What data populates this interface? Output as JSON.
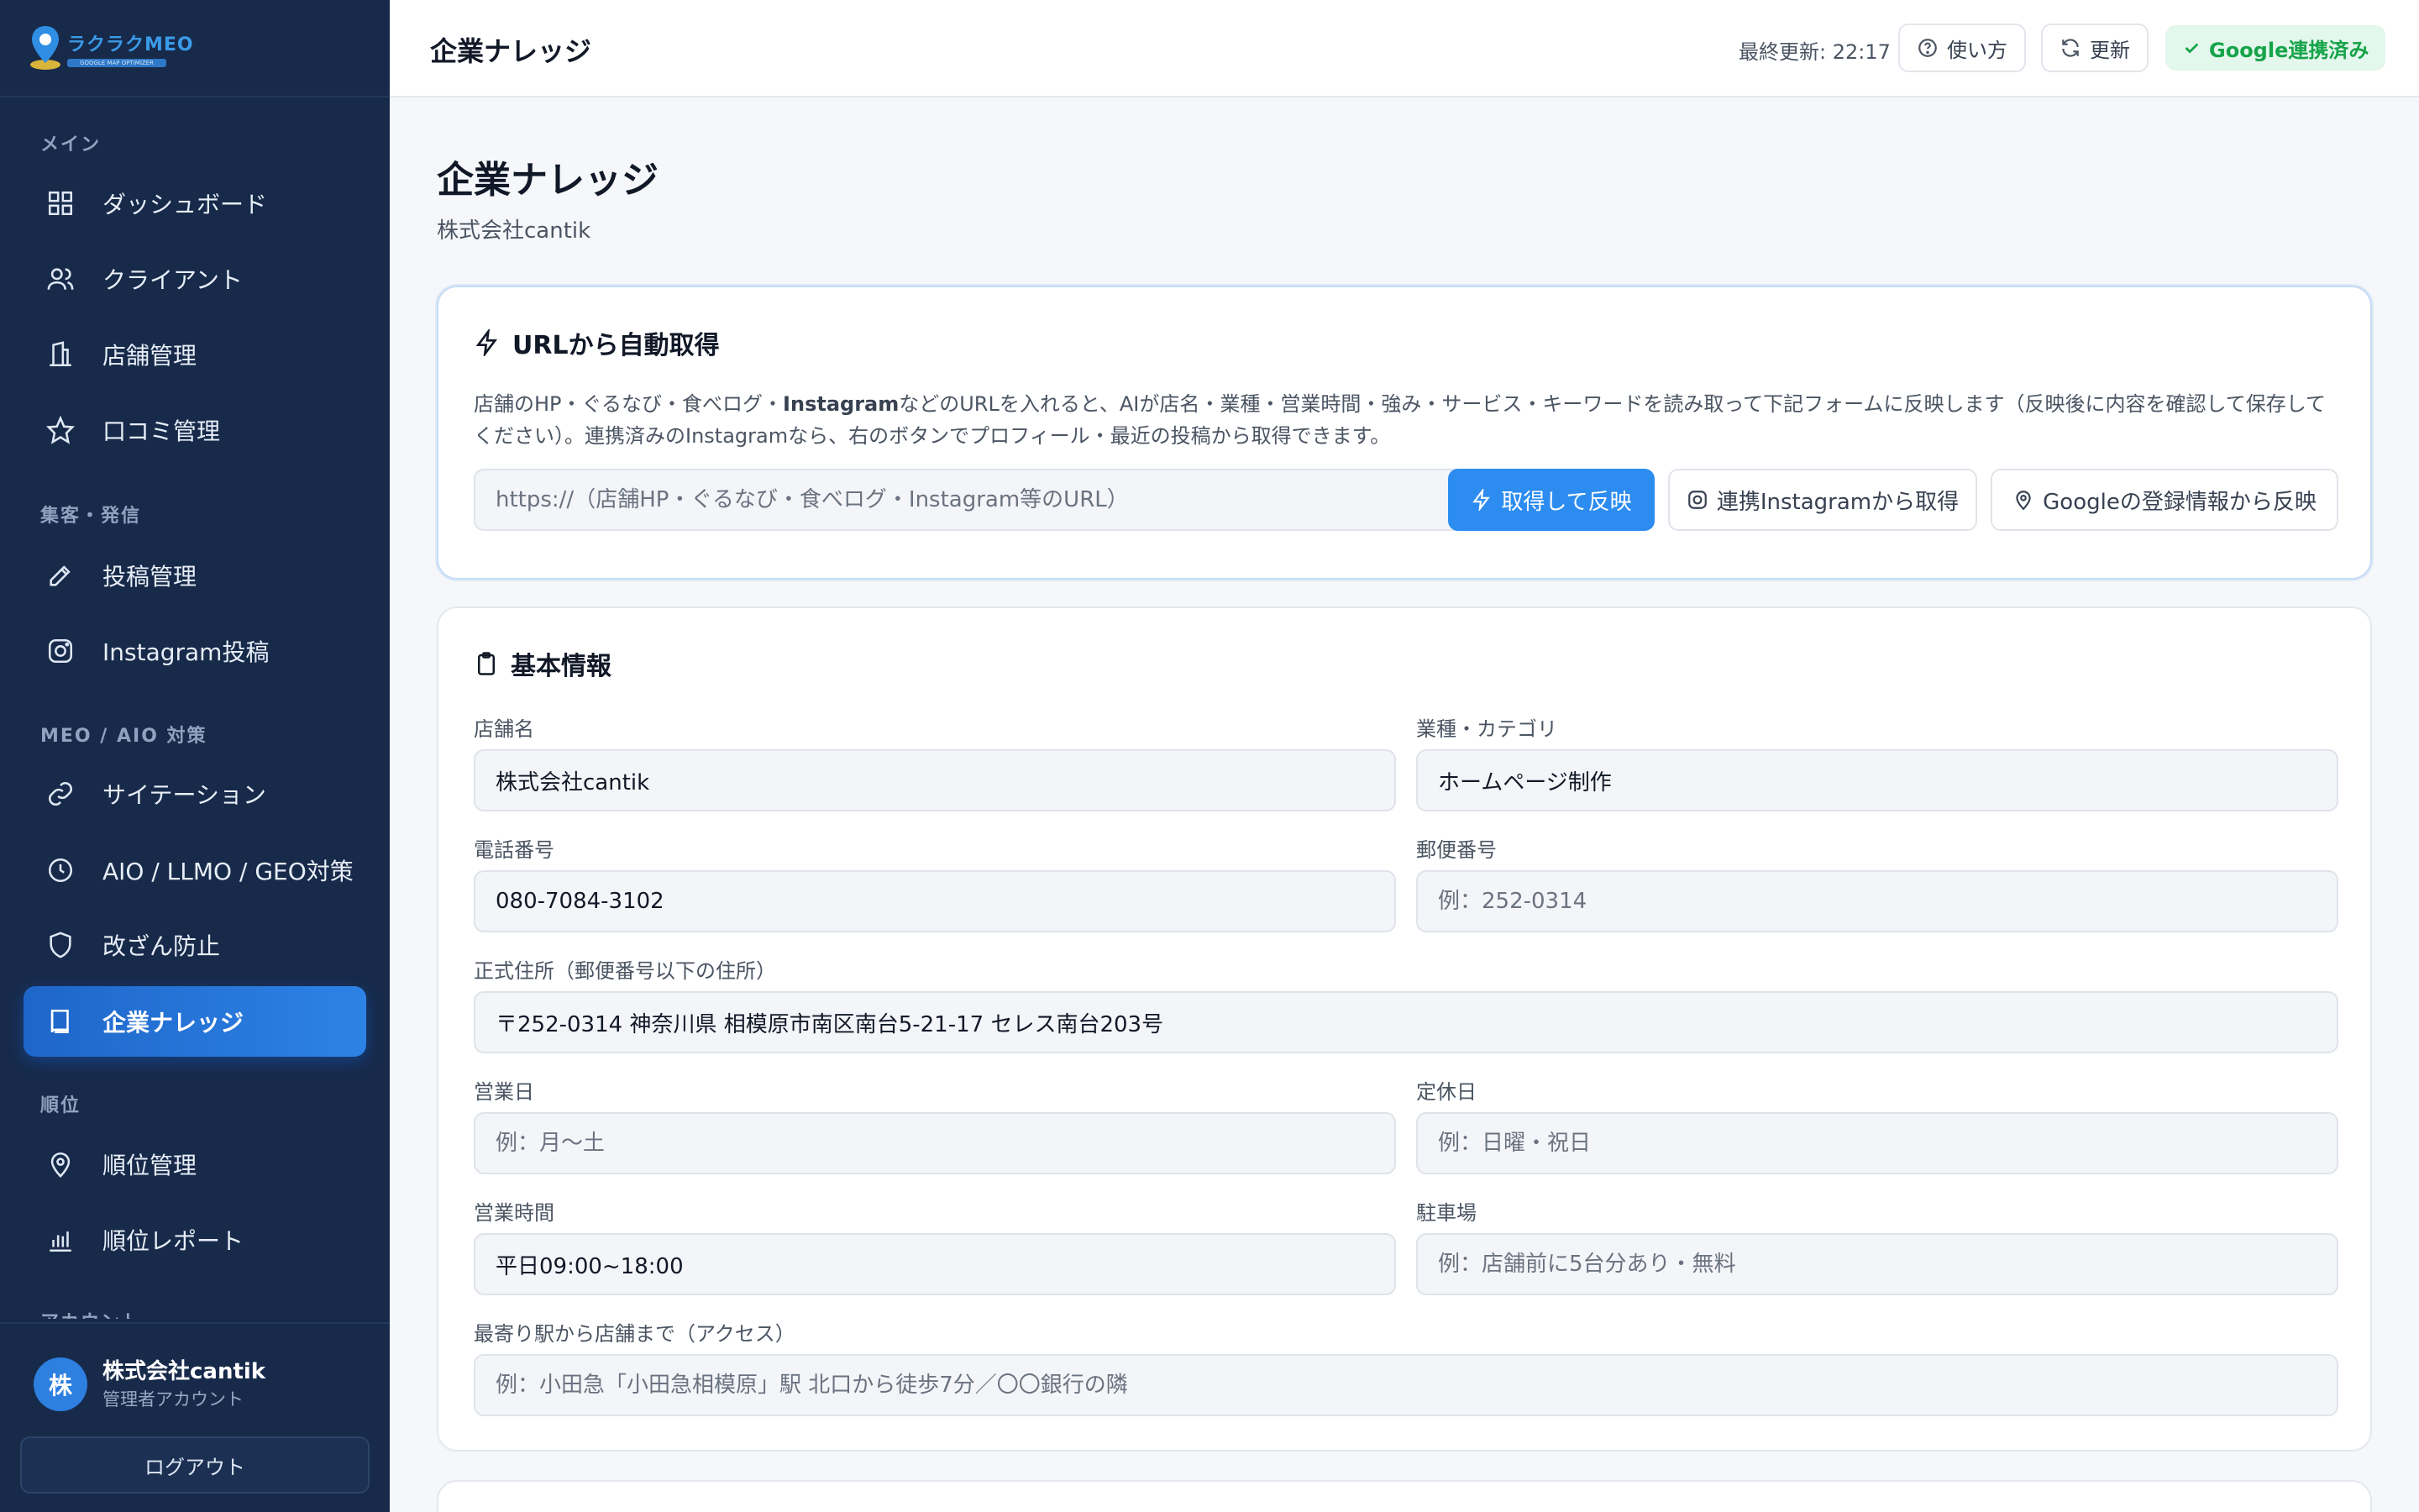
{
  "brand": {
    "name": "ラクラクMEO",
    "tagline": "GOOGLE MAP OPTIMIZER"
  },
  "sidebar": {
    "sections": {
      "main": "メイン",
      "attract": "集客・発信",
      "meo": "MEO / AIO 対策",
      "rank": "順位",
      "account": "アカウント"
    },
    "items": [
      {
        "label": "ダッシュボード"
      },
      {
        "label": "クライアント"
      },
      {
        "label": "店舗管理"
      },
      {
        "label": "口コミ管理"
      },
      {
        "label": "投稿管理"
      },
      {
        "label": "Instagram投稿"
      },
      {
        "label": "サイテーション"
      },
      {
        "label": "AIO / LLMO / GEO対策"
      },
      {
        "label": "改ざん防止"
      },
      {
        "label": "企業ナレッジ"
      },
      {
        "label": "順位管理"
      },
      {
        "label": "順位レポート"
      }
    ],
    "active_index": 9
  },
  "user": {
    "avatar": "株",
    "name": "株式会社cantik",
    "role": "管理者アカウント",
    "logout": "ログアウト"
  },
  "header": {
    "title": "企業ナレッジ",
    "last_update": "最終更新: 22:17",
    "help": "使い方",
    "refresh": "更新",
    "google": "Google連携済み"
  },
  "page": {
    "title": "企業ナレッジ",
    "subtitle": "株式会社cantik"
  },
  "auto_fetch": {
    "title": "URLから自動取得",
    "desc_pre": "店舗のHP・ぐるなび・食べログ・",
    "desc_bold": "Instagram",
    "desc_post": "などのURLを入れると、AIが店名・業種・営業時間・強み・サービス・キーワードを読み取って下記フォームに反映します（反映後に内容を確認して保存してください）。連携済みのInstagramなら、右のボタンでプロフィール・最近の投稿から取得できます。",
    "url_placeholder": "https://（店舗HP・ぐるなび・食べログ・Instagram等のURL）",
    "fetch_button": "取得して反映",
    "instagram_button": "連携Instagramから取得",
    "google_button": "Googleの登録情報から反映"
  },
  "basic": {
    "title": "基本情報",
    "store_name": {
      "label": "店舗名",
      "value": "株式会社cantik",
      "placeholder": ""
    },
    "category": {
      "label": "業種・カテゴリ",
      "value": "ホームページ制作",
      "placeholder": ""
    },
    "phone": {
      "label": "電話番号",
      "value": "080-7084-3102",
      "placeholder": ""
    },
    "postal": {
      "label": "郵便番号",
      "value": "",
      "placeholder": "例：252-0314"
    },
    "address": {
      "label": "正式住所（郵便番号以下の住所）",
      "value": "〒252-0314 神奈川県 相模原市南区南台5-21-17 セレス南台203号",
      "placeholder": ""
    },
    "open_days": {
      "label": "営業日",
      "value": "",
      "placeholder": "例：月〜土"
    },
    "closed_days": {
      "label": "定休日",
      "value": "",
      "placeholder": "例：日曜・祝日"
    },
    "hours": {
      "label": "営業時間",
      "value": "平日09:00~18:00",
      "placeholder": ""
    },
    "parking": {
      "label": "駐車場",
      "value": "",
      "placeholder": "例：店舗前に5台分あり・無料"
    },
    "access": {
      "label": "最寄り駅から店舗まで（アクセス）",
      "value": "",
      "placeholder": "例：小田急「小田急相模原」駅 北口から徒歩7分／〇〇銀行の隣"
    }
  },
  "colors": {
    "sidebar": "#172a4a",
    "accent": "#2d8cf0",
    "success": "#16a34a"
  }
}
